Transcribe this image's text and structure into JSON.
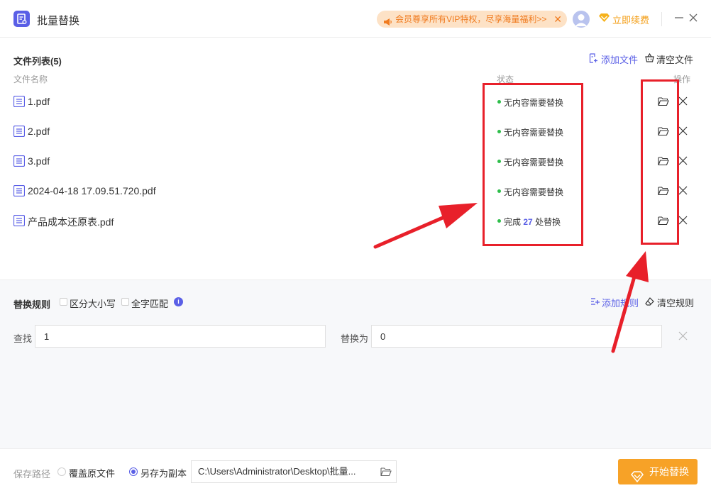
{
  "app": {
    "title": "批量替换"
  },
  "promo": {
    "text": "会员尊享所有VIP特权，尽享海量福利>>"
  },
  "header": {
    "renew_label": "立即续费"
  },
  "file_list": {
    "title": "文件列表(5)",
    "add_label": "添加文件",
    "clear_label": "清空文件",
    "columns": {
      "name": "文件名称",
      "status": "状态",
      "op": "操作"
    },
    "rows": [
      {
        "name": "1.pdf",
        "status": "无内容需要替换"
      },
      {
        "name": "2.pdf",
        "status": "无内容需要替换"
      },
      {
        "name": "3.pdf",
        "status": "无内容需要替换"
      },
      {
        "name": "2024-04-18 17.09.51.720.pdf",
        "status": "无内容需要替换"
      },
      {
        "name": "产品成本还原表.pdf",
        "status_prefix": "完成",
        "status_count": "27",
        "status_suffix": "处替换"
      }
    ]
  },
  "rules": {
    "title": "替换规则",
    "case_label": "区分大小写",
    "whole_label": "全字匹配",
    "add_label": "添加规则",
    "clear_label": "清空规则",
    "find_label": "查找",
    "find_value": "1",
    "replace_label": "替换为",
    "replace_value": "0"
  },
  "footer": {
    "save_label": "保存路径",
    "overwrite_label": "覆盖原文件",
    "copy_label": "另存为副本",
    "path": "C:\\Users\\Administrator\\Desktop\\批量...",
    "start_label": "开始替换"
  },
  "colors": {
    "accent": "#5a5fe6",
    "orange": "#f7a227",
    "annotation_red": "#e8202a",
    "status_green": "#2ebe4a"
  }
}
